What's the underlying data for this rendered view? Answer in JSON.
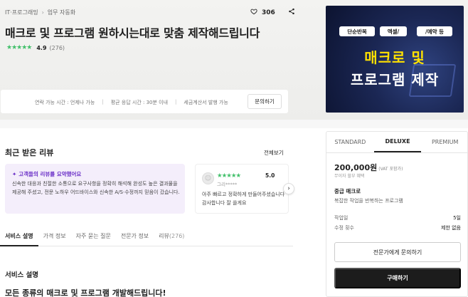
{
  "breadcrumb": {
    "category": "IT·프로그래밍",
    "separator": "›",
    "subcategory": "업무 자동화"
  },
  "actions": {
    "like_count": "306"
  },
  "header": {
    "title": "매크로 및 프로그램 원하시는대로 맞춤 제작해드립니다",
    "rating_score": "4.9",
    "rating_count": "(276)"
  },
  "info": {
    "contact_time": "연락 가능 시간 : 언제나 가능",
    "response_time": "평균 응답 시간 : 30분 이내",
    "tax_invoice": "세금계산서 발행 가능",
    "inquire_label": "문의하기"
  },
  "banner": {
    "chips": [
      "단순반복",
      "엑셀/",
      "/예약 등"
    ],
    "line1": "매크로 및",
    "line2": "프로그램 제작"
  },
  "reviews": {
    "section_title": "최근 받은 리뷰",
    "see_all": "전체보기",
    "ai_summary_title": "고객들의 리뷰를 요약했어요",
    "ai_summary_text": "신속한 대응과 친절한 소통으로 요구사항을 정확히 해석해 완성도 높은 결과물을 제공해 주셨고, 전문 노하우 어드바이스와 신속한 A/S·수정까지 믿음이 갔습니다.",
    "card": {
      "score": "5.0",
      "user": "그리*****",
      "text": "아주 빠르고 정확하게 만들어주셨습니다 감사합니다 잘 쓸게요"
    }
  },
  "tabs": [
    {
      "label": "서비스 설명",
      "count": ""
    },
    {
      "label": "가격 정보",
      "count": ""
    },
    {
      "label": "자주 묻는 질문",
      "count": ""
    },
    {
      "label": "전문가 정보",
      "count": ""
    },
    {
      "label": "리뷰",
      "count": "(276)"
    }
  ],
  "service": {
    "heading": "서비스 설명",
    "subheading": "모든 종류의 매크로 및 프로그램 개발해드립니다!"
  },
  "package": {
    "tabs": [
      "STANDARD",
      "DELUXE",
      "PREMIUM"
    ],
    "selected_tab": "DELUXE",
    "price": "200,000원",
    "vat": "(VAT 포함가)",
    "free_note": "무이자 할부 혜택",
    "plan_name": "중급 매크로",
    "plan_desc": "복잡한 작업을 반복하는 프로그램",
    "work_days_label": "작업일",
    "work_days_value": "5일",
    "revisions_label": "수정 횟수",
    "revisions_value": "제한 없음",
    "inquire_button": "전문가에게 문의하기",
    "buy_button": "구매하기"
  },
  "colors": {
    "star_green": "#42c06a",
    "ai_purple": "#6a2fc7",
    "banner_yellow": "#ffe100",
    "banner_navy": "#1b2754",
    "buy_button_bg": "#1c1c1c"
  }
}
